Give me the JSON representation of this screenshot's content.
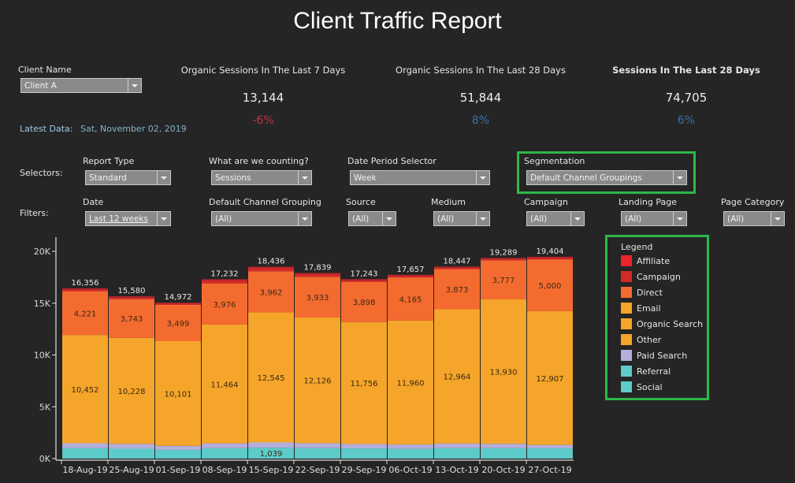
{
  "header": {
    "title": "Client Traffic Report"
  },
  "client": {
    "label": "Client Name",
    "value": "Client A"
  },
  "latest": {
    "label": "Latest Data:",
    "value": "Sat, November 02, 2019"
  },
  "kpis": [
    {
      "title": "Organic Sessions In The Last 7 Days",
      "value": "13,144",
      "change": "-6%",
      "color": "#c2334b"
    },
    {
      "title": "Organic Sessions In The Last 28 Days",
      "value": "51,844",
      "change": "8%",
      "color": "#3d6fa8"
    },
    {
      "title": "Sessions In The Last 28 Days",
      "value": "74,705",
      "change": "6%",
      "color": "#3d6fa8"
    }
  ],
  "selectors": {
    "row_label": "Selectors:",
    "items": [
      {
        "label": "Report Type",
        "value": "Standard"
      },
      {
        "label": "What are we counting?",
        "value": "Sessions"
      },
      {
        "label": "Date Period Selector",
        "value": "Week"
      },
      {
        "label": "Segmentation",
        "value": "Default Channel Groupings"
      }
    ]
  },
  "filters": {
    "row_label": "Filters:",
    "items": [
      {
        "label": "Date",
        "value": "Last 12 weeks"
      },
      {
        "label": "Default Channel Grouping",
        "value": "(All)"
      },
      {
        "label": "Source",
        "value": "(All)"
      },
      {
        "label": "Medium",
        "value": "(All)"
      },
      {
        "label": "Campaign",
        "value": "(All)"
      },
      {
        "label": "Landing Page",
        "value": "(All)"
      },
      {
        "label": "Page Category",
        "value": "(All)"
      }
    ]
  },
  "legend": {
    "title": "Legend",
    "items": [
      {
        "name": "Affiliate",
        "color": "#e8262e"
      },
      {
        "name": "Campaign",
        "color": "#d42a2a"
      },
      {
        "name": "Direct",
        "color": "#f46b30"
      },
      {
        "name": "Email",
        "color": "#f5a52a"
      },
      {
        "name": "Organic Search",
        "color": "#f5a52a"
      },
      {
        "name": "Other",
        "color": "#f5a52a"
      },
      {
        "name": "Paid Search",
        "color": "#b3aedb"
      },
      {
        "name": "Referral",
        "color": "#5ccbc9"
      },
      {
        "name": "Social",
        "color": "#5ccbc9"
      }
    ]
  },
  "chart_data": {
    "type": "bar",
    "stacked": true,
    "title": "",
    "xlabel": "",
    "ylabel": "",
    "ylim": [
      0,
      20000
    ],
    "yticks": [
      "0K",
      "5K",
      "10K",
      "15K",
      "20K"
    ],
    "ytick_values": [
      0,
      5000,
      10000,
      15000,
      20000
    ],
    "grid": false,
    "legend_position": "right",
    "categories": [
      "18-Aug-19",
      "25-Aug-19",
      "01-Sep-19",
      "08-Sep-19",
      "15-Sep-19",
      "22-Sep-19",
      "29-Sep-19",
      "06-Oct-19",
      "13-Oct-19",
      "20-Oct-19",
      "27-Oct-19"
    ],
    "totals": [
      16356,
      15580,
      14972,
      17232,
      18436,
      17839,
      17243,
      17657,
      18447,
      19289,
      19404
    ],
    "series": [
      {
        "name": "Referral",
        "color": "#5ccbc9",
        "values": [
          1000,
          950,
          830,
          1000,
          1039,
          1010,
          980,
          940,
          1000,
          1010,
          990
        ],
        "labels": [
          null,
          null,
          null,
          null,
          "1,039",
          null,
          null,
          null,
          null,
          null,
          null
        ]
      },
      {
        "name": "Paid Search",
        "color": "#b3aedb",
        "values": [
          480,
          470,
          400,
          470,
          520,
          480,
          430,
          420,
          450,
          420,
          330
        ],
        "labels": []
      },
      {
        "name": "Organic Search",
        "color": "#f5a52a",
        "values": [
          10452,
          10228,
          10101,
          11464,
          12545,
          12126,
          11756,
          11960,
          12964,
          13930,
          12907
        ],
        "labels": [
          "10,452",
          "10,228",
          "10,101",
          "11,464",
          "12,545",
          "12,126",
          "11,756",
          "11,960",
          "12,964",
          "13,930",
          "12,907"
        ]
      },
      {
        "name": "Direct",
        "color": "#f46b30",
        "values": [
          4221,
          3743,
          3499,
          3976,
          3962,
          3933,
          3898,
          4165,
          3873,
          3777,
          5000
        ],
        "labels": [
          "4,221",
          "3,743",
          "3,499",
          "3,976",
          "3,962",
          "3,933",
          "3,898",
          "4,165",
          "3,873",
          "3,777",
          "5,000"
        ]
      },
      {
        "name": "Campaign",
        "color": "#d42a2a",
        "values": [
          203,
          189,
          142,
          322,
          370,
          290,
          179,
          172,
          160,
          152,
          177
        ],
        "labels": []
      }
    ]
  }
}
